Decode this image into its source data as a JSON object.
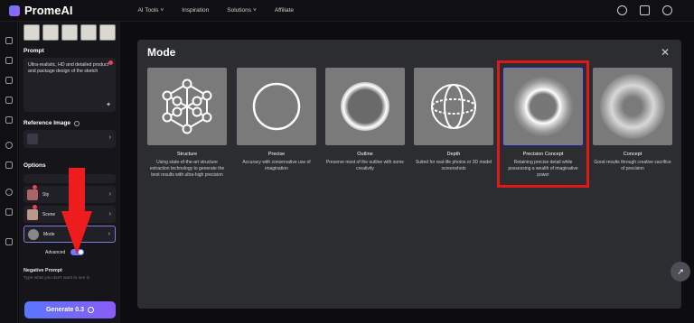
{
  "app": {
    "name": "PromeAI"
  },
  "nav": {
    "items": [
      "AI Tools",
      "Inspiration",
      "Solutions",
      "Affiliate"
    ]
  },
  "top_icons": [
    "headset-icon",
    "graduation-cap-icon",
    "globe-icon"
  ],
  "sidebar": {
    "prompt_title": "Prompt",
    "prompt_text": "Ultra-realistic, HD and detailed product and package design of the sketch",
    "reference_title": "Reference Image",
    "options_title": "Options",
    "options": [
      {
        "label": "Sty"
      },
      {
        "label": "Scene"
      },
      {
        "label": "Mode"
      }
    ],
    "advanced_label": "Advanced",
    "negative_title": "Negative Prompt",
    "negative_placeholder": "Type what you don't want to see in",
    "generate_label": "Generate 0.3"
  },
  "modal": {
    "title": "Mode",
    "cards": [
      {
        "name": "Structure",
        "desc": "Using state-of-the-art structure extraction technology to generate the best results with ultra-high precision"
      },
      {
        "name": "Precise",
        "desc": "Accuracy with conservative use of imagination"
      },
      {
        "name": "Outline",
        "desc": "Preserve most of the outline with some creativity"
      },
      {
        "name": "Depth",
        "desc": "Suited for real-life photos or 3D model screenshots"
      },
      {
        "name": "Precision Concept",
        "desc": "Retaining precise detail while possessing a wealth of imaginative power"
      },
      {
        "name": "Concept",
        "desc": "Good results through creative sacrifice of precision"
      }
    ]
  },
  "colors": {
    "accent": "#6a7bff",
    "highlight": "#e01818",
    "modal_bg": "#2b2d31"
  }
}
